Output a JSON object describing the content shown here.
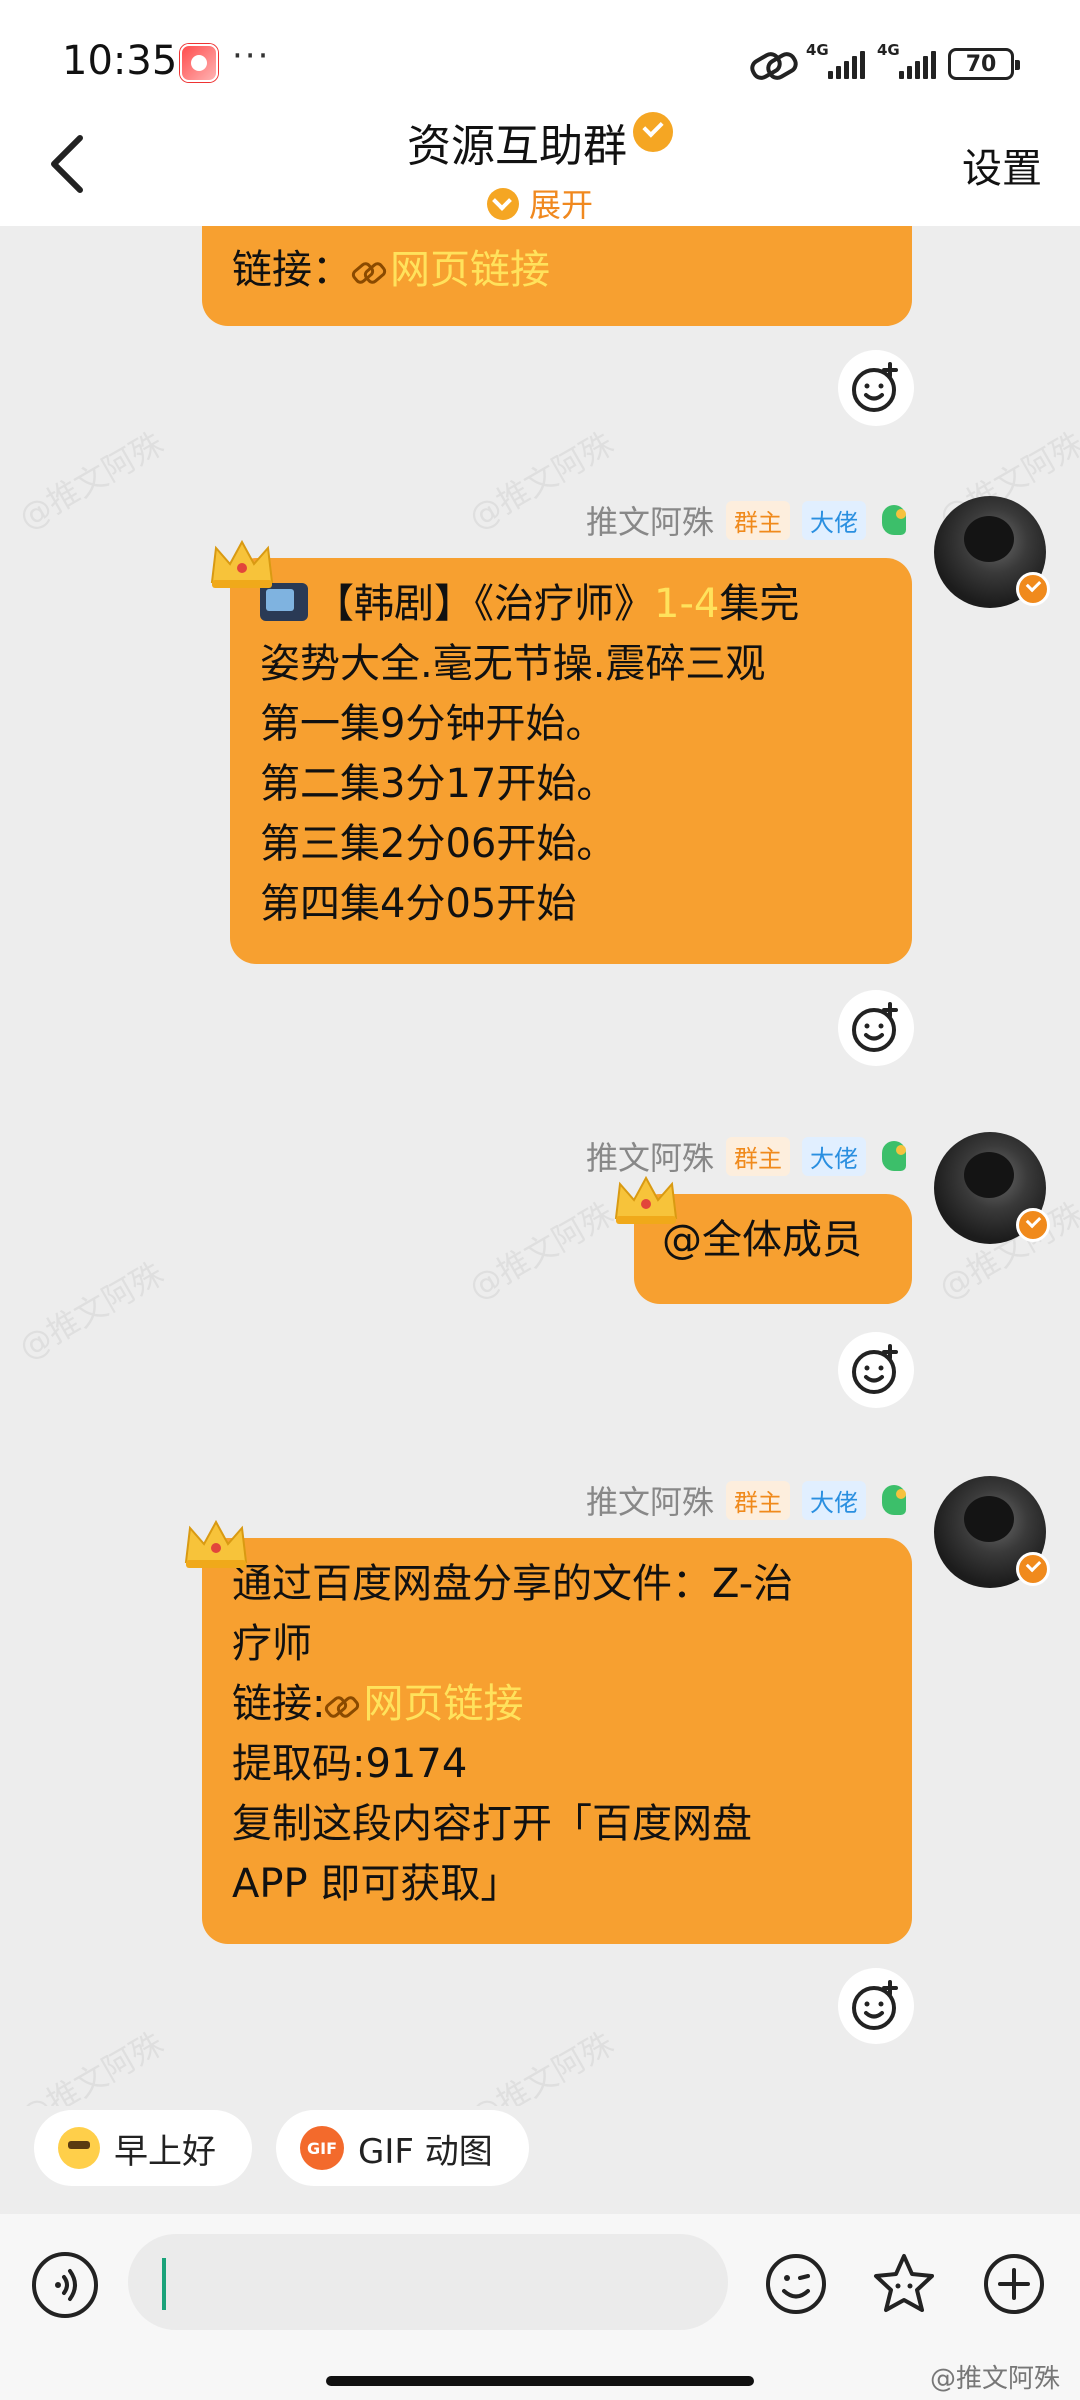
{
  "status_bar": {
    "time": "10:35",
    "dots": "···",
    "network1": "4G",
    "network2": "4G",
    "battery": "70"
  },
  "header": {
    "title": "资源互助群",
    "expand_label": "展开",
    "settings_label": "设置"
  },
  "messages": [
    {
      "partial": true,
      "lines": [
        "链接：",
        "网页链接"
      ]
    },
    {
      "sender": "推文阿殊",
      "tag_owner": "群主",
      "tag_boss": "大佬",
      "line1_a": "【韩剧】《治疗师》",
      "line1_hl": "1-4",
      "line1_b": "集完",
      "lines": [
        "姿势大全.毫无节操.震碎三观",
        "第一集9分钟开始。",
        "第二集3分17开始。",
        "第三集2分06开始。",
        "第四集4分05开始"
      ]
    },
    {
      "sender": "推文阿殊",
      "tag_owner": "群主",
      "tag_boss": "大佬",
      "text": "@全体成员"
    },
    {
      "sender": "推文阿殊",
      "tag_owner": "群主",
      "tag_boss": "大佬",
      "line1": "通过百度网盘分享的文件：Z-治",
      "line2": "疗师",
      "link_prefix": "链接:",
      "link_text": "网页链接",
      "code": "提取码:9174",
      "line5": "复制这段内容打开「百度网盘",
      "line6": "APP 即可获取」"
    }
  ],
  "quick_replies": [
    {
      "label": "早上好",
      "icon": "sun-sunglasses-emoji"
    },
    {
      "label": "GIF 动图",
      "icon_text": "GIF"
    }
  ],
  "watermark": "@推文阿殊",
  "bottom_watermark": "@推文阿殊",
  "colors": {
    "bubble": "#f7a030",
    "highlight": "#ffe25c",
    "accent": "#f08a1c",
    "background": "#ededed"
  }
}
